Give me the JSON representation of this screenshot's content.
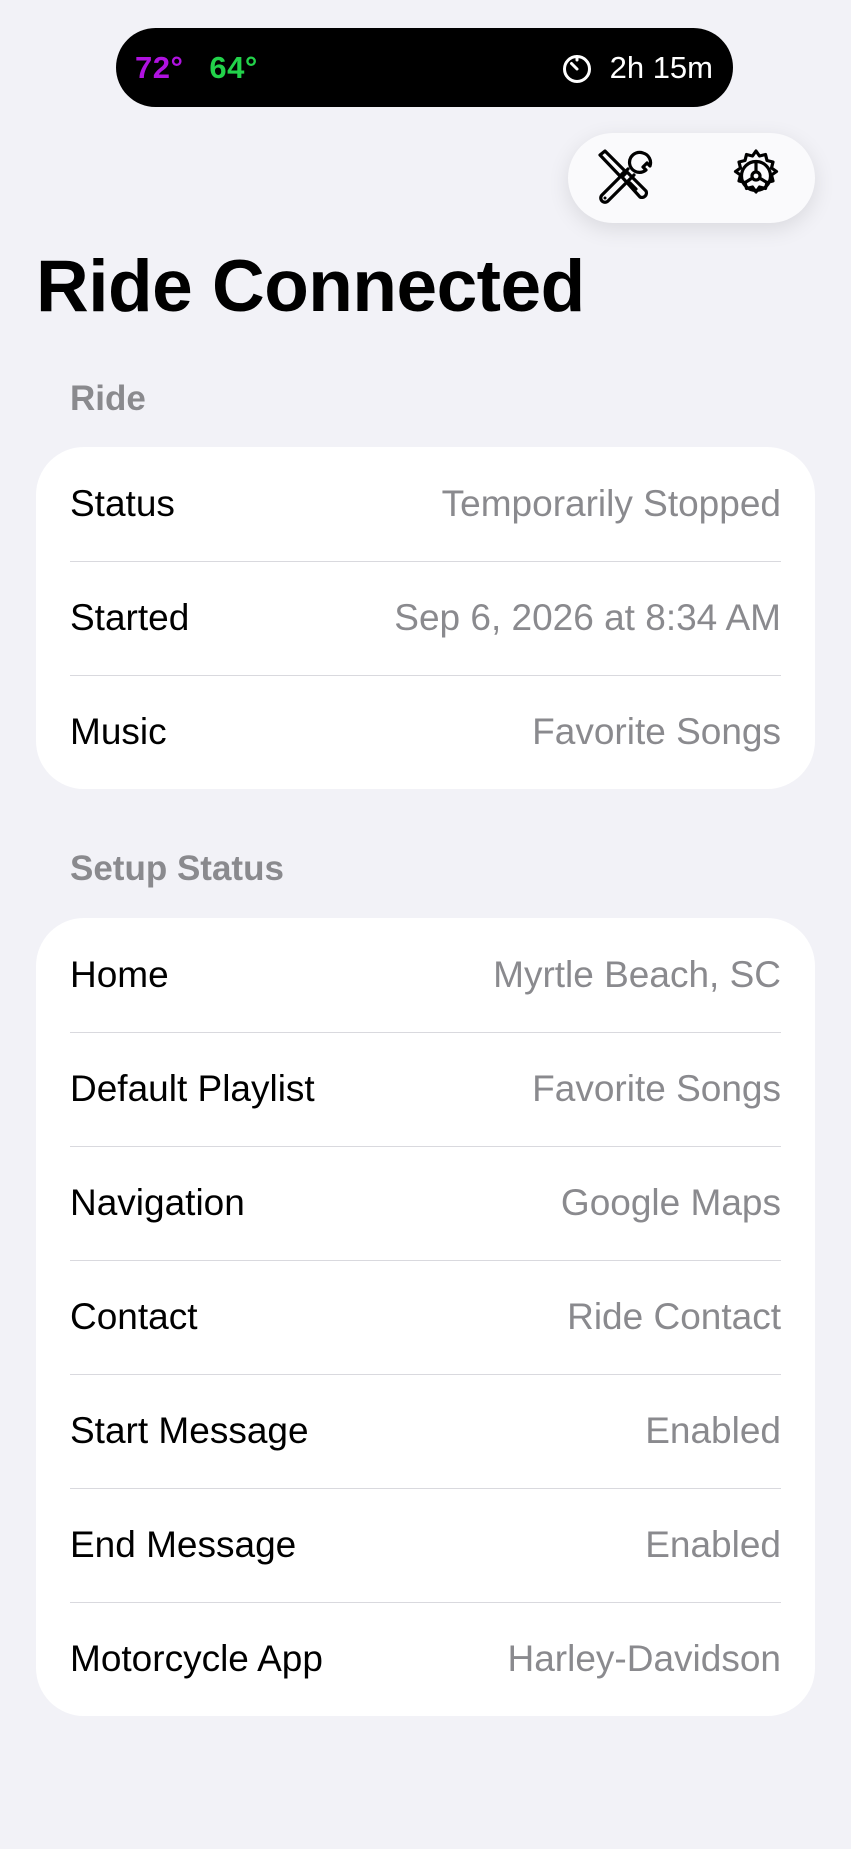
{
  "status_pill": {
    "temp_high": "72°",
    "temp_low": "64°",
    "timer_icon": "timer-icon",
    "elapsed": "2h 15m",
    "colors": {
      "temp_high": "#b012e0",
      "temp_low": "#22d24a"
    }
  },
  "toolbar": {
    "tools_icon": "wrench-screwdriver-icon",
    "settings_icon": "gear-icon"
  },
  "page": {
    "title": "Ride Connected"
  },
  "ride": {
    "header": "Ride",
    "rows": [
      {
        "label": "Status",
        "value": "Temporarily Stopped"
      },
      {
        "label": "Started",
        "value": "Sep 6, 2026 at 8:34 AM"
      },
      {
        "label": "Music",
        "value": "Favorite Songs"
      }
    ]
  },
  "setup": {
    "header": "Setup Status",
    "rows": [
      {
        "label": "Home",
        "value": "Myrtle Beach, SC"
      },
      {
        "label": "Default Playlist",
        "value": "Favorite Songs"
      },
      {
        "label": "Navigation",
        "value": "Google Maps"
      },
      {
        "label": "Contact",
        "value": "Ride Contact"
      },
      {
        "label": "Start Message",
        "value": "Enabled"
      },
      {
        "label": "End Message",
        "value": "Enabled"
      },
      {
        "label": "Motorcycle App",
        "value": "Harley-Davidson"
      }
    ]
  }
}
